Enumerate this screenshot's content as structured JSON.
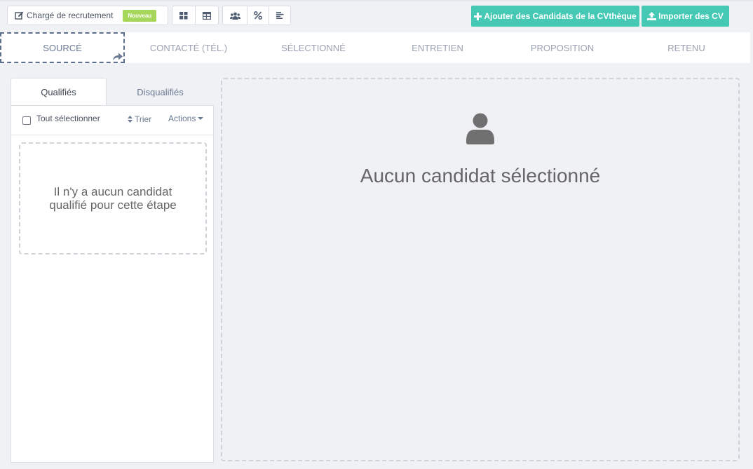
{
  "toolbar": {
    "recruiter_label": "Chargé de recrutement",
    "new_badge": "Nouveau",
    "add_candidates_label": "Ajouter des Candidats de la CVthèque",
    "import_cv_label": "Importer des CV"
  },
  "stages": [
    "SOURCÉ",
    "CONTACTÉ (TÉL.)",
    "SÉLECTIONNÉ",
    "ENTRETIEN",
    "PROPOSITION",
    "RETENU"
  ],
  "left_panel": {
    "tabs": [
      "Qualifiés",
      "Disqualifiés"
    ],
    "select_all": "Tout sélectionner",
    "sort": "Trier",
    "actions": "Actions",
    "empty_message": "Il n'y a aucun candidat qualifié pour cette étape"
  },
  "main": {
    "empty_message": "Aucun candidat sélectionné"
  },
  "colors": {
    "accent_green": "#45c8b4",
    "badge_green": "#a6d75b",
    "background": "#f0f1f5"
  }
}
